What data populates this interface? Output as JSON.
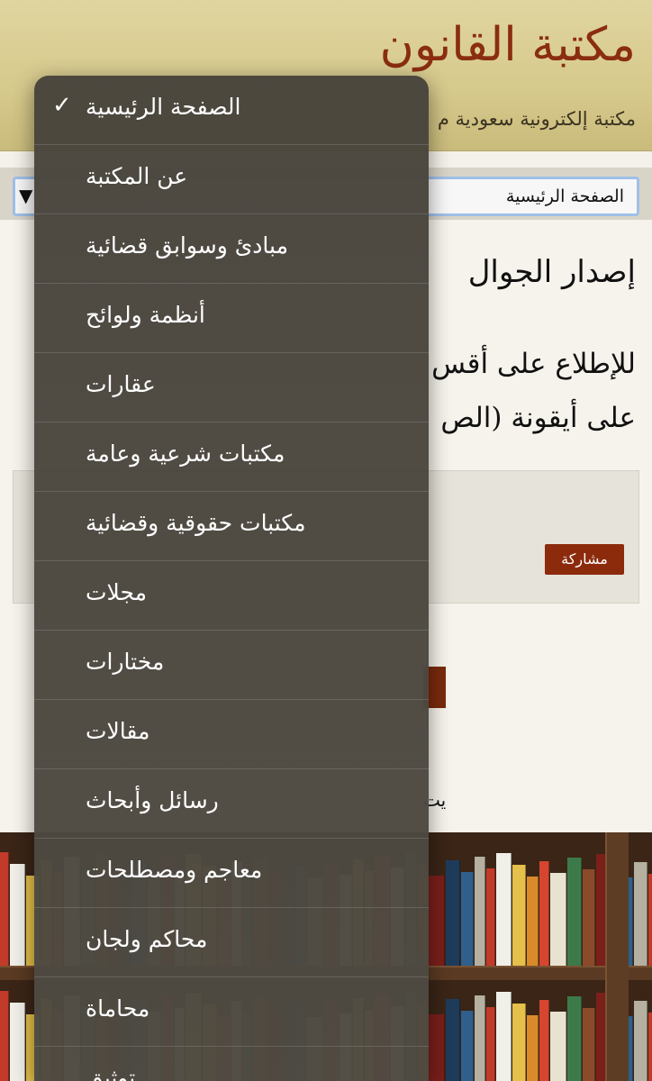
{
  "header": {
    "title": "مكتبة القانون",
    "subtitle": "مكتبة إلكترونية سعودية م"
  },
  "nav_select": {
    "value": "الصفحة الرئيسية",
    "arrow": "▼"
  },
  "main": {
    "mobile_title": "إصدار الجوال",
    "intro_line1": "للإطلاع على أقس",
    "intro_line2": "على أيقونة (الص",
    "share_label": "مشاركة",
    "partial_text": "يت"
  },
  "menu": {
    "selected_index": 0,
    "check_glyph": "✓",
    "items": [
      "الصفحة الرئيسية",
      "عن المكتبة",
      "مبادئ وسوابق قضائية",
      "أنظمة ولوائح",
      "عقارات",
      "مكتبات شرعية وعامة",
      "مكتبات حقوقية وقضائية",
      "مجلات",
      "مختارات",
      "مقالات",
      "رسائل وأبحاث",
      "معاجم ومصطلحات",
      "محاكم ولجان",
      "محاماة",
      "توثيق"
    ]
  },
  "colors": {
    "brand": "#8a2d10",
    "header_bg": "#d6c98c",
    "menu_bg": "#4a463e",
    "button": "#8c2b0c"
  }
}
